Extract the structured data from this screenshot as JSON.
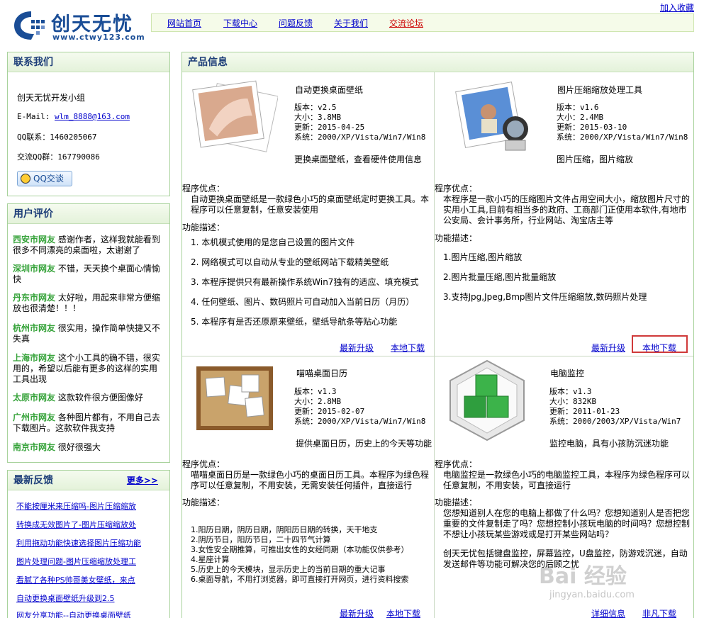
{
  "header": {
    "logo_title": "创天无忧",
    "logo_url": "www.ctwy123.com",
    "add_fav": "加入收藏",
    "nav": [
      "网站首页",
      "下载中心",
      "问题反馈",
      "关于我们",
      "交流论坛"
    ]
  },
  "contact": {
    "title": "联系我们",
    "team": "创天无忧开发小组",
    "email_label": "E-Mail: ",
    "email": "wlm_8888@163.com",
    "qq_label": "QQ联系：1460205067",
    "group_label": "交流QQ群：167790086",
    "qq_button": "QQ交谈"
  },
  "reviews": {
    "title": "用户评价",
    "items": [
      {
        "who": "西安市网友",
        "text": "感谢作者，这样我就能看到很多不同漂亮的桌面啦，太谢谢了"
      },
      {
        "who": "深圳市网友",
        "text": "不错，天天换个桌面心情愉快"
      },
      {
        "who": "丹东市网友",
        "text": "太好啦，用起来非常方便缩放也很清楚！！！"
      },
      {
        "who": "杭州市网友",
        "text": "很实用，操作简单快捷又不失真"
      },
      {
        "who": "上海市网友",
        "text": "这个小工具的确不错，很实用的，希望以后能有更多的这样的实用工具出现"
      },
      {
        "who": "太原市网友",
        "text": "这款软件很方便图像好"
      },
      {
        "who": "广州市网友",
        "text": "各种图片都有，不用自己去下载图片。这款软件我支持"
      },
      {
        "who": "南京市网友",
        "text": "很好很强大"
      }
    ]
  },
  "feedback": {
    "title": "最新反馈",
    "more": "更多>>",
    "items": [
      "不能按厘米来压缩吗-图片压缩缩放",
      "转换成无效图片了-图片压缩缩放处",
      "利用拖动功能快速选择图片压缩功能",
      "图片处理问题-图片压缩缩放处理工",
      "看腻了各种PS帅哥美女壁纸，来点",
      "自动更换桌面壁纸升级到2.5",
      "网友分享功能--自动更换桌面壁纸"
    ]
  },
  "main": {
    "title": "产品信息",
    "products": [
      {
        "name": "自动更换桌面壁纸",
        "version": "版本：v2.5",
        "size": "大小：3.8MB",
        "updated": "更新：2015-04-25",
        "system": "系统：2000/XP/Vista/Win7/Win8",
        "tagline": "更换桌面壁纸，查看硬件使用信息",
        "adv_title": "程序优点：",
        "adv": "自动更换桌面壁纸是一款绿色小巧的桌面壁纸定时更换工具。本程序可以任意复制，任意安装使用",
        "func_title": "功能描述：",
        "funcs": [
          "1. 本机模式使用的是您自己设置的图片文件",
          "2. 网络模式可以自动从专业的壁纸网站下载精美壁纸",
          "3. 本程序提供只有最新操作系统Win7独有的适应、填充模式",
          "4. 任何壁纸、图片、数码照片可自动加入当前日历（月历）",
          "5. 本程序有是否还原原来壁纸，壁纸导航条等贴心功能"
        ],
        "link1": "最新升级",
        "link2": "本地下载"
      },
      {
        "name": "图片压缩缩放处理工具",
        "version": "版本：v1.6",
        "size": "大小：2.4MB",
        "updated": "更新：2015-03-10",
        "system": "系统：2000/XP/Vista/Win7/Win8",
        "tagline": "图片压缩，图片缩放",
        "adv_title": "程序优点：",
        "adv": "本程序是一款小巧的压缩图片文件占用空间大小，缩放图片尺寸的实用小工具,目前有相当多的政府、工商部门正使用本软件,有地市公安局、会计事务所，行业网站、淘宝店主等",
        "func_title": "功能描述：",
        "funcs": [
          "1.图片压缩,图片缩放",
          "2.图片批量压缩,图片批量缩放",
          "3.支持Jpg,Jpeg,Bmp图片文件压缩缩放,数码照片处理"
        ],
        "link1": "最新升级",
        "link2": "本地下载"
      },
      {
        "name": "喵喵桌面日历",
        "version": "版本：v1.3",
        "size": "大小：2.8MB",
        "updated": "更新：2015-02-07",
        "system": "系统：2000/XP/Vista/Win7/Win8",
        "tagline": "提供桌面日历，历史上的今天等功能",
        "adv_title": "程序优点：",
        "adv": "喵喵桌面日历是一款绿色小巧的桌面日历工具。本程序为绿色程序可以任意复制，不用安装，无需安装任何插件，直接运行",
        "func_title": "功能描述：",
        "funcs": [
          "1.阳历日期，阴历日期，阴阳历日期的转换，天干地支",
          "2.阴历节日，阳历节日，二十四节气计算",
          "3.女性安全期推算，可推出女性的女经同期（本功能仅供参考）",
          "4.星座计算",
          "5.历史上的今天模块，显示历史上的当前日期的重大记事",
          "6.桌面导航，不用打浏览器，即可直接打开网页，进行资料搜索"
        ],
        "link1": "最新升级",
        "link2": "本地下载"
      },
      {
        "name": "电脑监控",
        "version": "版本：v1.3",
        "size": "大小：832KB",
        "updated": "更新：2011-01-23",
        "system": "系统：2000/2003/XP/Vista/Win7",
        "tagline": "监控电脑，具有小孩防沉迷功能",
        "adv_title": "程序优点：",
        "adv": "电脑监控是一款绿色小巧的电脑监控工具，本程序为绿色程序可以任意复制，不用安装，可直接运行",
        "func_title": "功能描述：",
        "funcs": [
          "您想知道别人在您的电脑上都做了什么吗？您想知道别人是否把您重要的文件复制走了吗？您想控制小孩玩电脑的时间吗？您想控制不想让小孩玩某些游戏或是打开某些网站吗？",
          "创天无忧包括键盘监控，屏幕监控，U盘监控，防游戏沉迷，自动发送邮件等功能可解决您的后顾之忧"
        ],
        "link1": "详细信息",
        "link2": "非凡下载"
      }
    ]
  },
  "watermark": {
    "main": "Bai 经验",
    "sub": "jingyan.baidu.com"
  },
  "colors": {
    "accent": "#36a33a",
    "link": "#0000cc",
    "title": "#1c3d78",
    "highlight": "#d03a3a"
  }
}
